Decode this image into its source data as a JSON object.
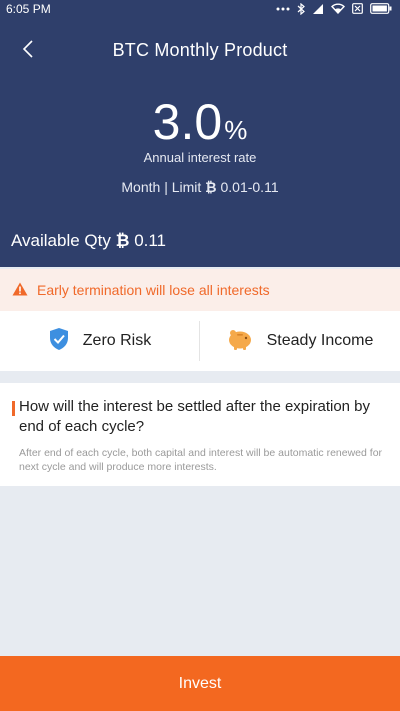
{
  "status_bar": {
    "time": "6:05 PM",
    "icons": [
      "more-icon",
      "bluetooth-icon",
      "signal-icon",
      "wifi-icon",
      "sim-icon",
      "battery-icon"
    ]
  },
  "header": {
    "title": "BTC Monthly Product",
    "rate_value": "3.0",
    "rate_unit": "%",
    "rate_label": "Annual interest rate",
    "term": "Month",
    "limit_label": "Limit",
    "currency_symbol": "₿",
    "limit_range": "0.01-0.11",
    "available_label": "Available Qty",
    "available_value": "0.11"
  },
  "warning": {
    "text": "Early termination will lose all interests",
    "color": "#f0692a"
  },
  "features": [
    {
      "label": "Zero Risk",
      "icon": "shield-check-icon"
    },
    {
      "label": "Steady Income",
      "icon": "piggy-bank-icon"
    }
  ],
  "faq": {
    "question": "How will the interest be settled after the expiration by end of each cycle?",
    "answer": "After end of each cycle, both capital and interest will be automatic renewed for next cycle and will produce more interests."
  },
  "invest": {
    "label": "Invest",
    "color": "#f36820"
  },
  "colors": {
    "header_bg": "#2f3f6b",
    "accent": "#f36820",
    "page_bg": "#e7ebf1"
  }
}
